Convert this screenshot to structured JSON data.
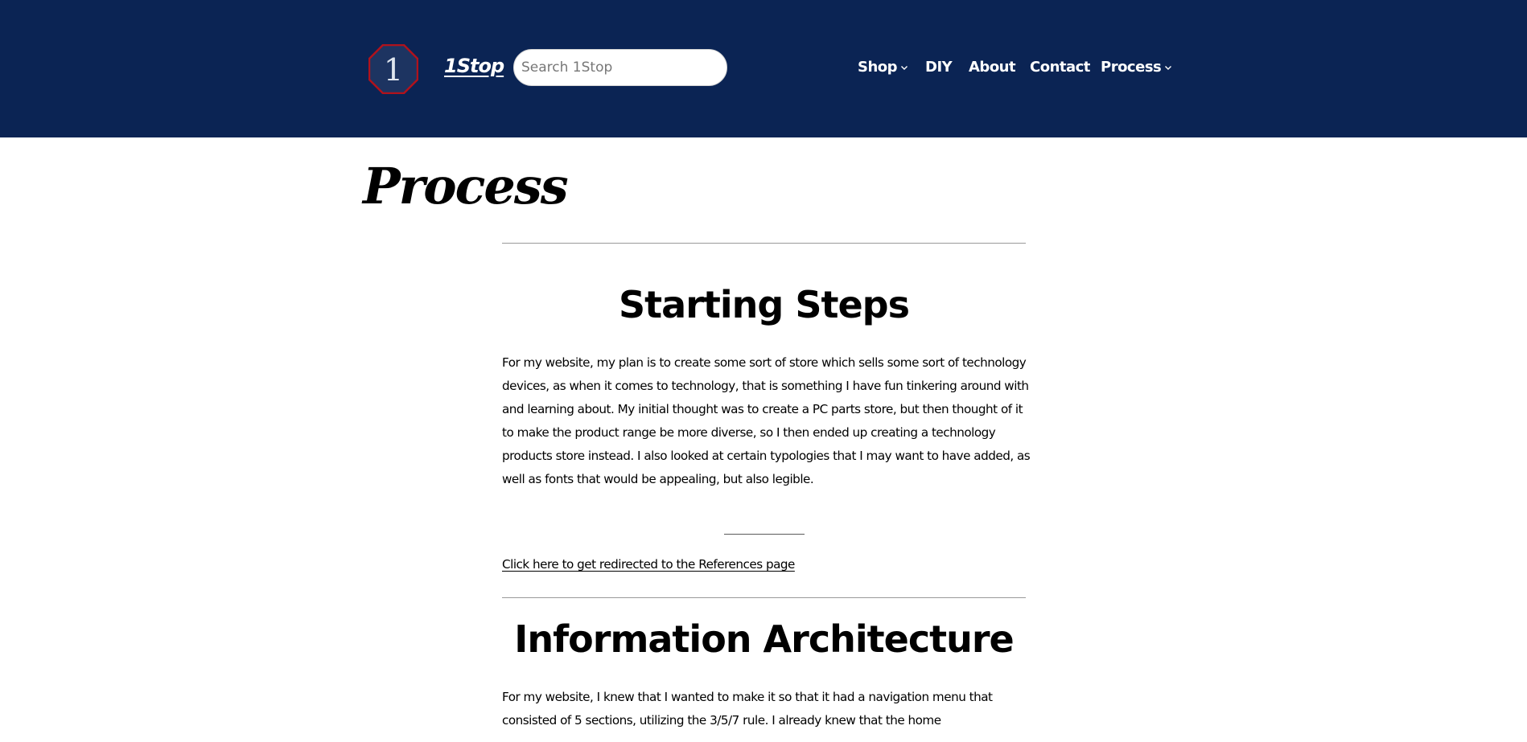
{
  "header": {
    "logo_text": "1",
    "site_title": "1Stop",
    "search_placeholder": "Search 1Stop",
    "nav": [
      {
        "label": "Shop",
        "has_dropdown": true
      },
      {
        "label": "DIY",
        "has_dropdown": false
      },
      {
        "label": "About",
        "has_dropdown": false
      },
      {
        "label": "Contact",
        "has_dropdown": false
      },
      {
        "label": "Process",
        "has_dropdown": true
      }
    ]
  },
  "page": {
    "title": "Process"
  },
  "sections": [
    {
      "heading": "Starting Steps",
      "body": "For my website, my plan is to create some sort of store which sells some sort of technology devices, as when it comes to technology, that is something I have fun tinkering around with and learning about. My initial thought was to create a PC parts store, but then thought of it to make the product range be more diverse, so I then ended up creating a technology products store instead. I also looked at certain typologies that I may want to have added, as well as fonts that would be appealing, but also legible.",
      "link": "Click here to get redirected to the References page"
    },
    {
      "heading": "Information Architecture",
      "body": "For my website, I knew that I wanted to make it so that it had a navigation menu that consisted of 5 sections, utilizing the 3/5/7 rule. I already knew that the home"
    }
  ],
  "colors": {
    "header_bg": "#0b2454",
    "logo_fill": "#1d3461",
    "logo_border": "#b0121c",
    "text": "#000000",
    "nav_text": "#ffffff"
  },
  "icons": {
    "logo": "octagon-logo-icon",
    "dropdown": "chevron-down-icon"
  }
}
